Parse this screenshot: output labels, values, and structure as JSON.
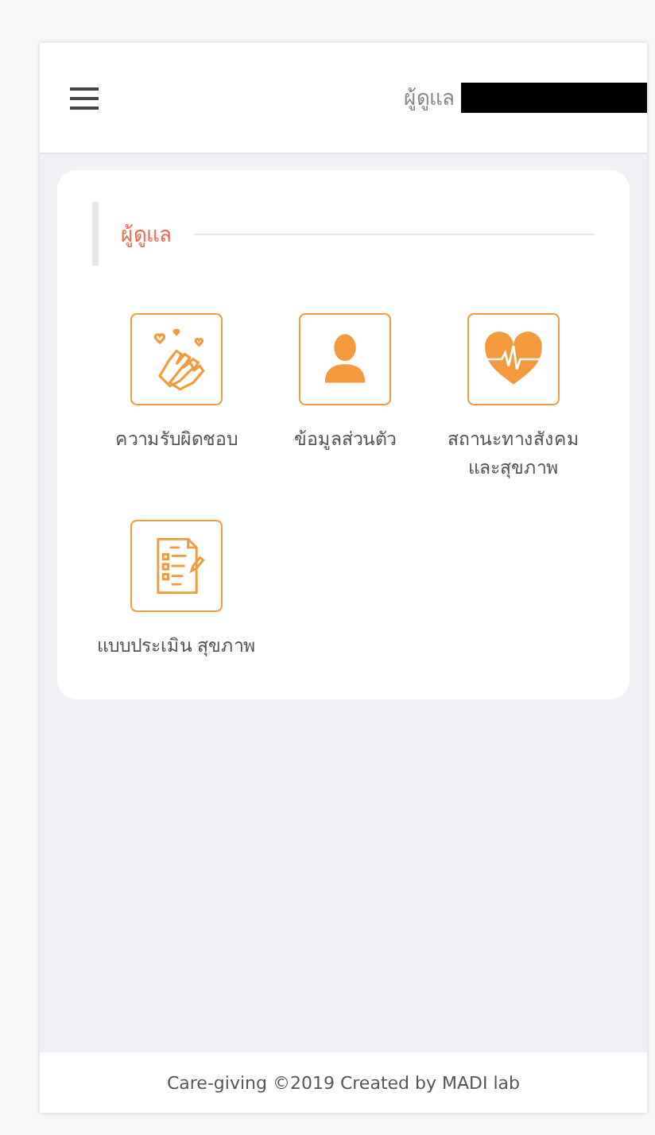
{
  "header": {
    "user_label": "ผู้ดูแล"
  },
  "section": {
    "title": "ผู้ดูแล"
  },
  "items": [
    {
      "kind": "hands",
      "label": "ความรับผิดชอบ"
    },
    {
      "kind": "person",
      "label": "ข้อมูลส่วนตัว"
    },
    {
      "kind": "heart",
      "label": "สถานะทางสังคม และสุขภาพ"
    },
    {
      "kind": "checklist",
      "label": "แบบประเมิน สุขภาพ"
    }
  ],
  "footer": "Care-giving ©2019 Created by MADI lab"
}
